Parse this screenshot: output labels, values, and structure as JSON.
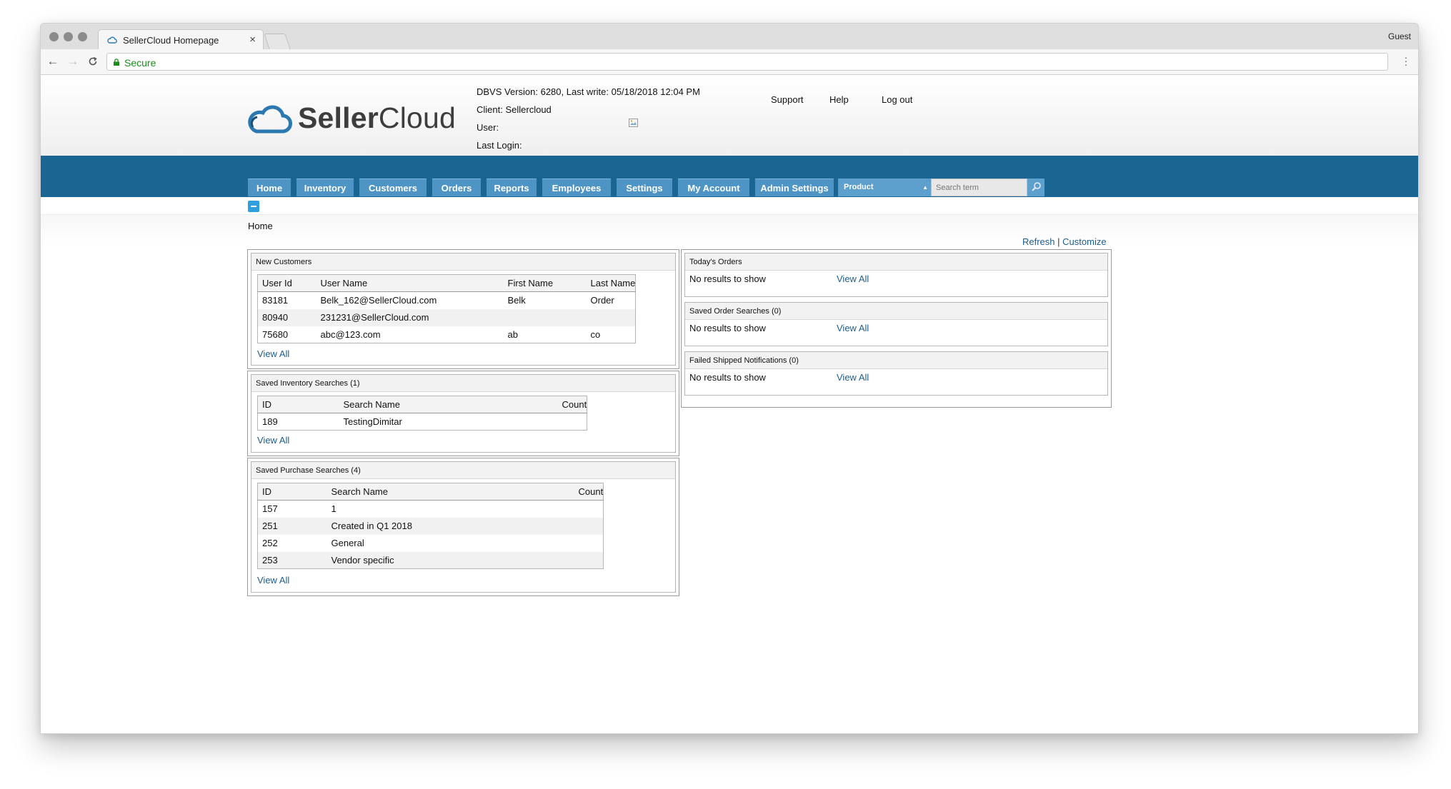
{
  "browser": {
    "tab_title": "SellerCloud Homepage",
    "close_glyph": "×",
    "profile": "Guest",
    "secure_label": "Secure",
    "back_glyph": "←",
    "forward_glyph": "→",
    "reload_glyph": "C"
  },
  "header": {
    "logo_light": "Seller",
    "logo_bold": "",
    "logo_rest": "Cloud",
    "dbvs": "DBVS Version: 6280, Last write: 05/18/2018 12:04 PM",
    "client": "Client: Sellercloud",
    "user": "User:",
    "last_login": "Last Login:",
    "links": [
      "Support",
      "Help",
      "Log out"
    ]
  },
  "nav": {
    "items": [
      "Home",
      "Inventory",
      "Customers",
      "Orders",
      "Reports",
      "Employees",
      "Settings",
      "My Account",
      "Admin Settings"
    ],
    "product_select": "Product",
    "search_placeholder": "Search term"
  },
  "breadcrumb": "Home",
  "actions": {
    "refresh": "Refresh",
    "separator": "|",
    "customize": "Customize"
  },
  "new_customers": {
    "title": "New Customers",
    "columns": [
      "User Id",
      "User Name",
      "First Name",
      "Last Name"
    ],
    "rows": [
      [
        "83181",
        "Belk_162@SellerCloud.com",
        "Belk",
        "Order"
      ],
      [
        "80940",
        "231231@SellerCloud.com",
        "",
        ""
      ],
      [
        "75680",
        "abc@123.com",
        "ab",
        "co"
      ]
    ],
    "view_all": "View All"
  },
  "saved_inventory": {
    "title": "Saved Inventory Searches (1)",
    "columns": [
      "ID",
      "Search Name",
      "Count"
    ],
    "rows": [
      [
        "189",
        "TestingDimitar",
        ""
      ]
    ],
    "view_all": "View All"
  },
  "saved_purchase": {
    "title": "Saved Purchase Searches (4)",
    "columns": [
      "ID",
      "Search Name",
      "Count"
    ],
    "rows": [
      [
        "157",
        "1",
        ""
      ],
      [
        "251",
        "Created in Q1 2018",
        ""
      ],
      [
        "252",
        "General",
        ""
      ],
      [
        "253",
        "Vendor specific",
        ""
      ]
    ],
    "view_all": "View All"
  },
  "todays_orders": {
    "title": "Today's Orders",
    "empty": "No results to show",
    "view_all": "View All"
  },
  "saved_orders": {
    "title": "Saved Order Searches (0)",
    "empty": "No results to show",
    "view_all": "View All"
  },
  "failed_shipped": {
    "title": "Failed Shipped Notifications (0)",
    "empty": "No results to show",
    "view_all": "View All"
  },
  "colors": {
    "nav_bar": "#1b6592",
    "menu_button": "#4e95c6",
    "link": "#1f5d8c",
    "secure": "#1e8b1e"
  }
}
